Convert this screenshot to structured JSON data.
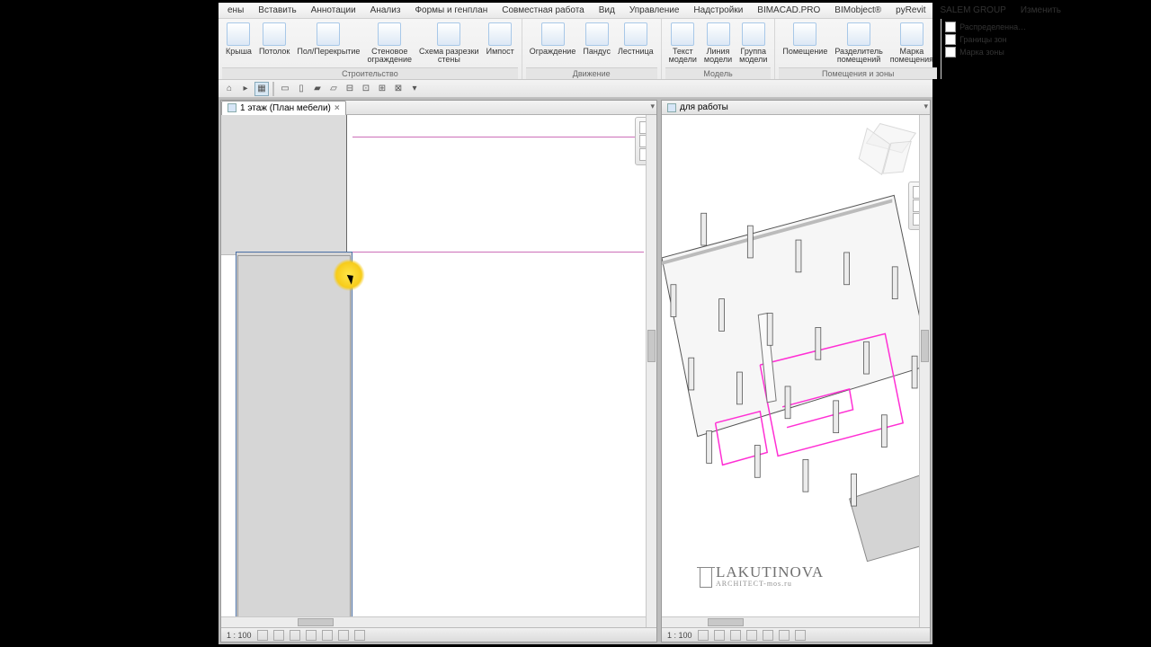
{
  "menu": {
    "items": [
      "ены",
      "Вставить",
      "Аннотации",
      "Анализ",
      "Формы и генплан",
      "Совместная работа",
      "Вид",
      "Управление",
      "Надстройки",
      "BIMACAD.PRO",
      "BIMobject®",
      "pyRevit",
      "SALEM GROUP",
      "Изменить"
    ]
  },
  "ribbon": {
    "groups": [
      {
        "label": "Строительство",
        "buttons": [
          {
            "label": "Крыша"
          },
          {
            "label": "Потолок"
          },
          {
            "label": "Пол/Перекрытие"
          },
          {
            "label": "Стеновое\nограждение"
          },
          {
            "label": "Схема разрезки\nстены"
          },
          {
            "label": "Импост"
          }
        ]
      },
      {
        "label": "Движение",
        "buttons": [
          {
            "label": "Ограждение"
          },
          {
            "label": "Пандус"
          },
          {
            "label": "Лестница"
          }
        ]
      },
      {
        "label": "Модель",
        "buttons": [
          {
            "label": "Текст\nмодели"
          },
          {
            "label": "Линия\nмодели"
          },
          {
            "label": "Группа\nмодели"
          }
        ]
      },
      {
        "label": "Помещения и зоны",
        "buttons": [
          {
            "label": "Помещение"
          },
          {
            "label": "Разделитель\nпомещений"
          },
          {
            "label": "Марка\nпомещения"
          }
        ]
      }
    ],
    "side": [
      "Распределенна…",
      "Границы зон",
      "Марка зоны"
    ]
  },
  "views": {
    "left": {
      "tab": "1 этаж (План мебели)",
      "scale": "1 : 100"
    },
    "right": {
      "tab": "для работы",
      "scale": "1 : 100"
    }
  },
  "watermark": {
    "name": "LAKUTINOVA",
    "sub": "ARCHITECT-mos.ru"
  }
}
